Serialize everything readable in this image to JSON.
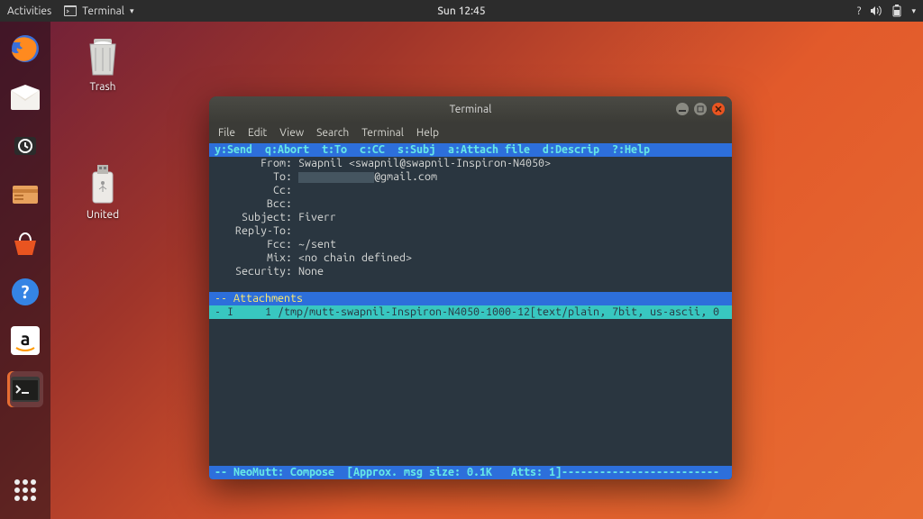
{
  "topbar": {
    "activities": "Activities",
    "app_label": "Terminal",
    "clock": "Sun 12:45"
  },
  "desktop": {
    "trash_label": "Trash",
    "usb_label": "United"
  },
  "window": {
    "title": "Terminal",
    "menu": {
      "file": "File",
      "edit": "Edit",
      "view": "View",
      "search": "Search",
      "terminal": "Terminal",
      "help": "Help"
    }
  },
  "mutt": {
    "shortcut_bar": "y:Send  q:Abort  t:To  c:CC  s:Subj  a:Attach file  d:Descrip  ?:Help",
    "from_label": "From:",
    "from_value": "Swapnil <swapnil@swapnil-Inspiron-N4050>",
    "to_label": "To:",
    "to_value_suffix": "@gmail.com",
    "cc_label": "Cc:",
    "cc_value": "",
    "bcc_label": "Bcc:",
    "bcc_value": "",
    "subject_label": "Subject:",
    "subject_value": "Fiverr",
    "reply_label": "Reply-To:",
    "reply_value": "",
    "fcc_label": "Fcc:",
    "fcc_value": "~/sent",
    "mix_label": "Mix:",
    "mix_value": "<no chain defined>",
    "security_label": "Security:",
    "security_value": "None",
    "attach_header": "-- Attachments",
    "attach_row": "- I     1 /tmp/mutt-swapnil-Inspiron-N4050-1000-12[text/plain, 7bit, us-ascii, 0",
    "status": "-- NeoMutt: Compose  [Approx. msg size: 0.1K   Atts: 1]-------------------------"
  }
}
